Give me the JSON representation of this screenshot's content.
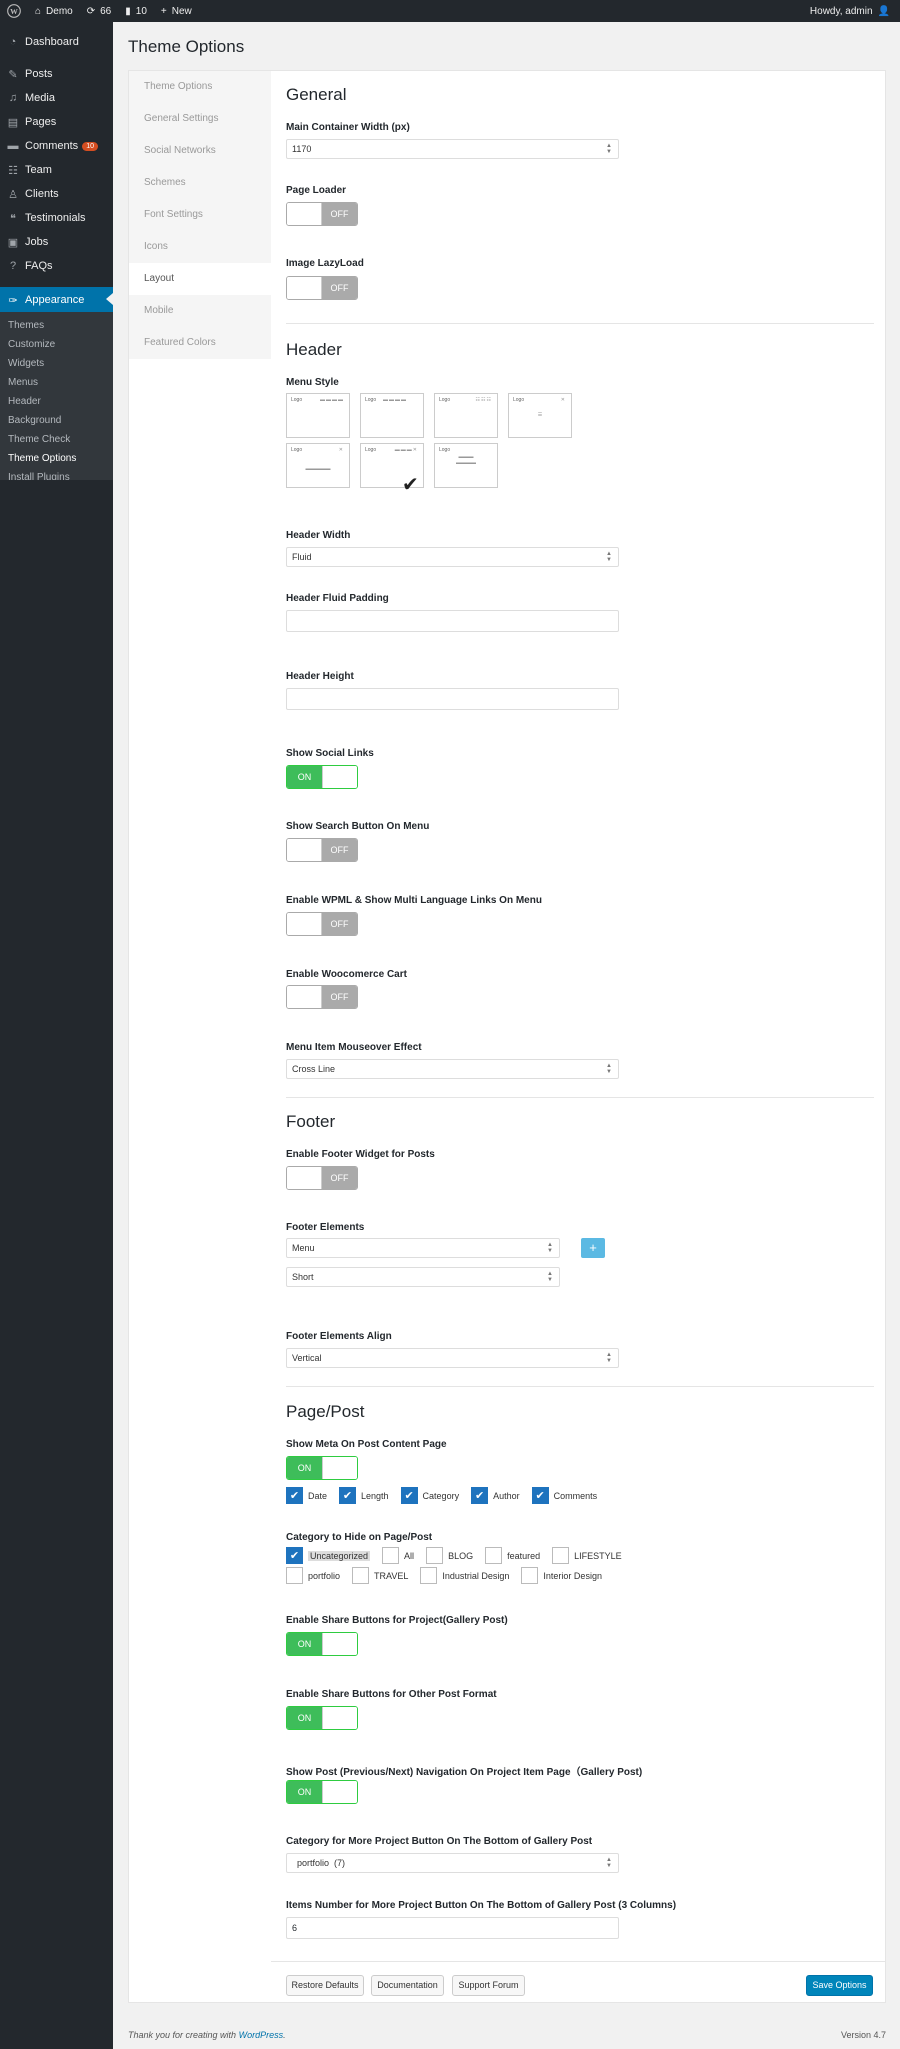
{
  "admin_bar": {
    "site_name": "Demo",
    "updates_count": "66",
    "comments_count": "10",
    "new_label": "New",
    "howdy": "Howdy, admin"
  },
  "sidebar": {
    "items": [
      {
        "label": "Dashboard",
        "icon": "dashboard-icon"
      },
      {
        "label": "Posts",
        "icon": "pin-icon"
      },
      {
        "label": "Media",
        "icon": "media-icon"
      },
      {
        "label": "Pages",
        "icon": "page-icon"
      },
      {
        "label": "Comments",
        "icon": "comment-icon",
        "badge": "10"
      },
      {
        "label": "Team",
        "icon": "team-icon"
      },
      {
        "label": "Clients",
        "icon": "user-icon"
      },
      {
        "label": "Testimonials",
        "icon": "quote-icon"
      },
      {
        "label": "Jobs",
        "icon": "jobs-icon"
      },
      {
        "label": "FAQs",
        "icon": "help-icon"
      },
      {
        "label": "Appearance",
        "icon": "brush-icon"
      }
    ],
    "submenu": [
      "Themes",
      "Customize",
      "Widgets",
      "Menus",
      "Header",
      "Background",
      "Theme Check",
      "Theme Options",
      "Install Plugins"
    ]
  },
  "page_title": "Theme Options",
  "tabs": [
    "Theme Options",
    "General Settings",
    "Social Networks",
    "Schemes",
    "Font Settings",
    "Icons",
    "Layout",
    "Mobile",
    "Featured Colors"
  ],
  "general": {
    "title": "General",
    "container_width_label": "Main Container Width (px)",
    "container_width_value": "1170",
    "page_loader_label": "Page Loader",
    "lazyload_label": "Image LazyLoad"
  },
  "toggle": {
    "on": "ON",
    "off": "OFF"
  },
  "header": {
    "title": "Header",
    "menu_style_label": "Menu Style",
    "logo_text": "Logo",
    "header_width_label": "Header Width",
    "header_width_value": "Fluid",
    "fluid_padding_label": "Header Fluid Padding",
    "height_label": "Header Height",
    "social_links_label": "Show Social Links",
    "search_button_label": "Show Search Button On Menu",
    "wpml_label": "Enable WPML & Show Multi Language Links On Menu",
    "woo_label": "Enable Woocomerce Cart",
    "mouseover_label": "Menu Item Mouseover Effect",
    "mouseover_value": "Cross Line"
  },
  "footer": {
    "title": "Footer",
    "widget_label": "Enable Footer Widget for Posts",
    "elements_label": "Footer Elements",
    "element1": "Menu",
    "element2": "Short",
    "align_label": "Footer Elements Align",
    "align_value": "Vertical"
  },
  "pagepost": {
    "title": "Page/Post",
    "meta_label": "Show Meta On Post Content Page",
    "meta_options": [
      "Date",
      "Length",
      "Category",
      "Author",
      "Comments"
    ],
    "hide_cat_label": "Category to Hide on Page/Post",
    "cat_row1": [
      "Uncategorized",
      "All",
      "BLOG",
      "featured",
      "LIFESTYLE"
    ],
    "cat_row2": [
      "portfolio",
      "TRAVEL",
      "Industrial Design",
      "Interior Design"
    ],
    "share_project_label": "Enable Share Buttons for Project(Gallery Post)",
    "share_other_label": "Enable Share Buttons for Other Post Format",
    "nav_label": "Show Post (Previous/Next) Navigation On Project Item Page（Gallery Post)",
    "more_cat_label": "Category for More Project Button On The Bottom of Gallery Post",
    "more_cat_value": "portfolio  (7)",
    "items_number_label": "Items Number for More Project Button On The Bottom of Gallery Post (3 Columns)",
    "items_number_value": "6"
  },
  "buttons": {
    "restore": "Restore Defaults",
    "docs": "Documentation",
    "support": "Support Forum",
    "save": "Save Options"
  },
  "footer_bar": {
    "thanks": "Thank you for creating with",
    "wp_link": "WordPress",
    "period": ".",
    "version": "Version 4.7"
  }
}
